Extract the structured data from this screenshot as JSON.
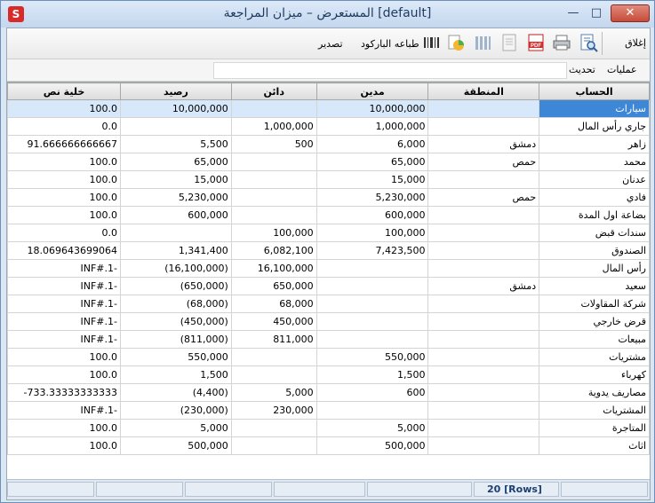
{
  "window": {
    "title": "المستعرض – ميزان المراجعة [default]",
    "icon": "app-logo-icon",
    "controls": {
      "minimize": "—",
      "maximize": "□",
      "close": "✕"
    }
  },
  "toolbar": {
    "close_label": "إغلاق",
    "barcode_label": "طباعه الباركود",
    "export_label": "تصدير",
    "icons": [
      "preview-icon",
      "print-icon",
      "pdf-icon",
      "document-icon",
      "columns-icon",
      "chart-icon",
      "barcode-icon"
    ]
  },
  "menu": {
    "operations": "عمليات",
    "refresh": "تحديث"
  },
  "grid": {
    "columns": [
      "الحساب",
      "المنطقة",
      "مدين",
      "دائن",
      "رصيد",
      "خلية نص"
    ],
    "rows": [
      {
        "account": "سيارات",
        "region": "",
        "debit": "10,000,000",
        "credit": "",
        "balance": "10,000,000",
        "text": "100.0"
      },
      {
        "account": "جاري رأس المال",
        "region": "",
        "debit": "1,000,000",
        "credit": "1,000,000",
        "balance": "",
        "text": "0.0"
      },
      {
        "account": "زاهر",
        "region": "دمشق",
        "debit": "6,000",
        "credit": "500",
        "balance": "5,500",
        "text": "91.666666666667"
      },
      {
        "account": "محمد",
        "region": "حمص",
        "debit": "65,000",
        "credit": "",
        "balance": "65,000",
        "text": "100.0"
      },
      {
        "account": "عدنان",
        "region": "",
        "debit": "15,000",
        "credit": "",
        "balance": "15,000",
        "text": "100.0"
      },
      {
        "account": "فادي",
        "region": "حمص",
        "debit": "5,230,000",
        "credit": "",
        "balance": "5,230,000",
        "text": "100.0"
      },
      {
        "account": "بضاعة اول المدة",
        "region": "",
        "debit": "600,000",
        "credit": "",
        "balance": "600,000",
        "text": "100.0"
      },
      {
        "account": "سندات قبض",
        "region": "",
        "debit": "100,000",
        "credit": "100,000",
        "balance": "",
        "text": "0.0"
      },
      {
        "account": "الصندوق",
        "region": "",
        "debit": "7,423,500",
        "credit": "6,082,100",
        "balance": "1,341,400",
        "text": "18.069643699064"
      },
      {
        "account": "رأس المال",
        "region": "",
        "debit": "",
        "credit": "16,100,000",
        "balance": "(16,100,000)",
        "text": "INF#.1-"
      },
      {
        "account": "سعيد",
        "region": "دمشق",
        "debit": "",
        "credit": "650,000",
        "balance": "(650,000)",
        "text": "INF#.1-"
      },
      {
        "account": "شركة المقاولات",
        "region": "",
        "debit": "",
        "credit": "68,000",
        "balance": "(68,000)",
        "text": "INF#.1-"
      },
      {
        "account": "قرض خارجي",
        "region": "",
        "debit": "",
        "credit": "450,000",
        "balance": "(450,000)",
        "text": "INF#.1-"
      },
      {
        "account": "مبيعات",
        "region": "",
        "debit": "",
        "credit": "811,000",
        "balance": "(811,000)",
        "text": "INF#.1-"
      },
      {
        "account": "مشتريات",
        "region": "",
        "debit": "550,000",
        "credit": "",
        "balance": "550,000",
        "text": "100.0"
      },
      {
        "account": "كهرباء",
        "region": "",
        "debit": "1,500",
        "credit": "",
        "balance": "1,500",
        "text": "100.0"
      },
      {
        "account": "مصاريف يدوية",
        "region": "",
        "debit": "600",
        "credit": "5,000",
        "balance": "(4,400)",
        "text": "-733.33333333333"
      },
      {
        "account": "المشتريات",
        "region": "",
        "debit": "",
        "credit": "230,000",
        "balance": "(230,000)",
        "text": "INF#.1-"
      },
      {
        "account": "المتاجرة",
        "region": "",
        "debit": "5,000",
        "credit": "",
        "balance": "5,000",
        "text": "100.0"
      },
      {
        "account": "اثاث",
        "region": "",
        "debit": "500,000",
        "credit": "",
        "balance": "500,000",
        "text": "100.0"
      }
    ],
    "selected_row": 0
  },
  "status": {
    "rows_label": "20 [Rows]"
  }
}
